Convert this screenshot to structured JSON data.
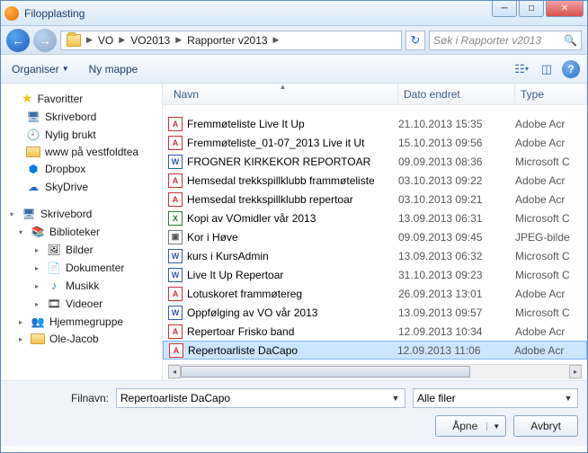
{
  "window": {
    "title": "Filopplasting"
  },
  "nav": {
    "crumbs": [
      "VO",
      "VO2013",
      "Rapporter v2013"
    ],
    "search_placeholder": "Søk i Rapporter v2013"
  },
  "toolbar": {
    "organize": "Organiser",
    "newfolder": "Ny mappe"
  },
  "sidebar": {
    "favorites": "Favoritter",
    "fav_items": [
      "Skrivebord",
      "Nylig brukt",
      "www på vestfoldtea",
      "Dropbox",
      "SkyDrive"
    ],
    "desktop": "Skrivebord",
    "libraries": "Biblioteker",
    "lib_items": [
      "Bilder",
      "Dokumenter",
      "Musikk",
      "Videoer"
    ],
    "homegroup": "Hjemmegruppe",
    "user": "Ole-Jacob"
  },
  "columns": {
    "name": "Navn",
    "date": "Dato endret",
    "type": "Type"
  },
  "files": [
    {
      "icon": "pdf",
      "name": "Fremmøteliste Live It Up",
      "date": "21.10.2013 15:35",
      "type": "Adobe Acr"
    },
    {
      "icon": "pdf",
      "name": "Fremmøteliste_01-07_2013 Live it Ut",
      "date": "15.10.2013 09:56",
      "type": "Adobe Acr"
    },
    {
      "icon": "doc",
      "name": "FROGNER KIRKEKOR REPORTOAR",
      "date": "09.09.2013 08:36",
      "type": "Microsoft C"
    },
    {
      "icon": "pdf",
      "name": "Hemsedal trekkspillklubb frammøteliste",
      "date": "03.10.2013 09:22",
      "type": "Adobe Acr"
    },
    {
      "icon": "pdf",
      "name": "Hemsedal trekkspillklubb repertoar",
      "date": "03.10.2013 09:21",
      "type": "Adobe Acr"
    },
    {
      "icon": "xls",
      "name": "Kopi av VOmidler vår 2013",
      "date": "13.09.2013 06:31",
      "type": "Microsoft C"
    },
    {
      "icon": "jpg",
      "name": "Kor i Høve",
      "date": "09.09.2013 09:45",
      "type": "JPEG-bilde"
    },
    {
      "icon": "doc",
      "name": "kurs i KursAdmin",
      "date": "13.09.2013 06:32",
      "type": "Microsoft C"
    },
    {
      "icon": "doc",
      "name": "Live It Up Repertoar",
      "date": "31.10.2013 09:23",
      "type": "Microsoft C"
    },
    {
      "icon": "pdf",
      "name": "Lotuskoret frammøtereg",
      "date": "26.09.2013 13:01",
      "type": "Adobe Acr"
    },
    {
      "icon": "doc",
      "name": "Oppfølging av VO vår 2013",
      "date": "13.09.2013 09:57",
      "type": "Microsoft C"
    },
    {
      "icon": "pdf",
      "name": "Repertoar Frisko band",
      "date": "12.09.2013 10:34",
      "type": "Adobe Acr"
    },
    {
      "icon": "pdf",
      "name": "Repertoarliste DaCapo",
      "date": "12.09.2013 11:06",
      "type": "Adobe Acr",
      "selected": true
    }
  ],
  "bottom": {
    "filename_label": "Filnavn:",
    "filename_value": "Repertoarliste DaCapo",
    "filter": "Alle filer",
    "open": "Åpne",
    "cancel": "Avbryt"
  }
}
